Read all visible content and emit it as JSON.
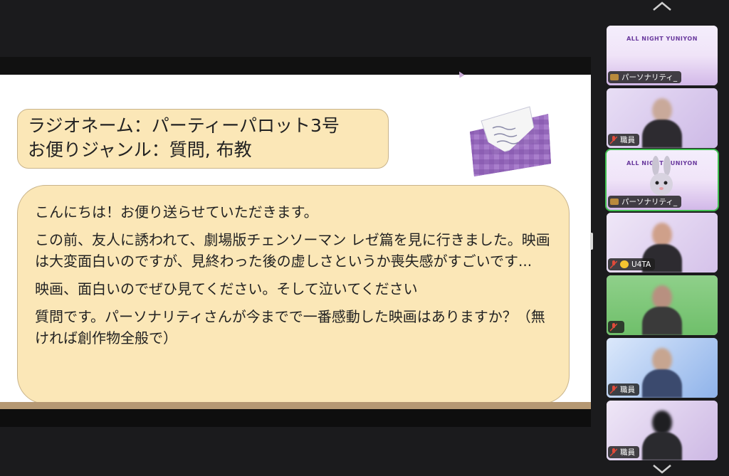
{
  "slide": {
    "radio_name_line": "ラジオネーム：パーティーパロット3号",
    "genre_line": "お便りジャンル：質問, 布教",
    "message_paragraphs": [
      "こんにちは！お便り送らせていただきます。",
      "この前、友人に誘われて、劇場版チェンソーマン レゼ篇を見に行きました。映画は大変面白いのですが、見終わった後の虚しさというか喪失感がすごいです...",
      "映画、面白いのでぜひ見てください。そして泣いてください",
      "質問です。パーソナリティさんが今までで一番感動した映画はありますか？（無ければ創作物全般で）"
    ]
  },
  "participants": [
    {
      "label": "パーソナリティ_",
      "icon": "radio-icon",
      "poster_title": "ALL NIGHT YUNIYON"
    },
    {
      "label": "職員",
      "icon": "mic-muted-icon"
    },
    {
      "label": "パーソナリティ_",
      "icon": "radio-icon",
      "poster_title": "ALL NIGHT YUNIYON"
    },
    {
      "label": "U4TA",
      "icon": "chick-icon"
    },
    {
      "label": "",
      "icon": "mic-muted-icon"
    },
    {
      "label": "職員",
      "icon": "mic-muted-icon"
    },
    {
      "label": "職員",
      "icon": "mic-muted-icon"
    }
  ],
  "colors": {
    "slide_box": "#fbe7b7",
    "active_speaker": "#3fbf4f",
    "muted": "#e04a3a"
  }
}
